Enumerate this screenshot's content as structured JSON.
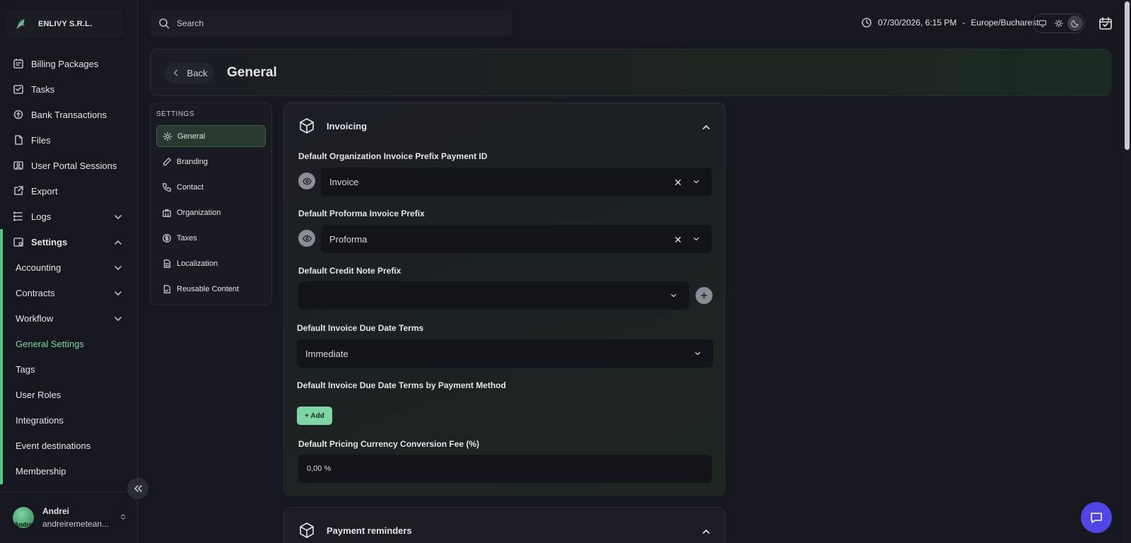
{
  "org": {
    "name": "ENLIVY S.R.L."
  },
  "sidebar": {
    "items": [
      {
        "label": "Billing Packages",
        "icon": "package-icon"
      },
      {
        "label": "Tasks",
        "icon": "tasks-icon"
      },
      {
        "label": "Bank Transactions",
        "icon": "bank-icon"
      },
      {
        "label": "Files",
        "icon": "file-icon"
      },
      {
        "label": "User Portal Sessions",
        "icon": "portal-icon"
      },
      {
        "label": "Export",
        "icon": "export-icon"
      },
      {
        "label": "Logs",
        "icon": "logs-icon"
      },
      {
        "label": "Settings",
        "icon": "settings-icon"
      }
    ],
    "sub_items": [
      "Accounting",
      "Contracts",
      "Workflow",
      "General Settings",
      "Tags",
      "User Roles",
      "Integrations",
      "Event destinations",
      "Membership"
    ],
    "active_sub": "General Settings"
  },
  "user": {
    "name": "Andrei",
    "email": "andreiremetean...",
    "avatar_text": "Andre"
  },
  "topbar": {
    "search_placeholder": "Search",
    "datetime": "07/30/2026, 6:15 PM",
    "separator": "-",
    "timezone": "Europe/Bucharest",
    "theme": "dark"
  },
  "header": {
    "back_label": "Back",
    "title": "General"
  },
  "settings_nav": {
    "title": "SETTINGS",
    "items": [
      "General",
      "Branding",
      "Contact",
      "Organization",
      "Taxes",
      "Localization",
      "Reusable Content"
    ],
    "active": "General"
  },
  "invoicing": {
    "title": "Invoicing",
    "org_prefix_label": "Default Organization Invoice Prefix Payment ID",
    "org_prefix_value": "Invoice",
    "proforma_label": "Default Proforma Invoice Prefix",
    "proforma_value": "Proforma",
    "credit_note_label": "Default Credit Note Prefix",
    "credit_note_value": "",
    "due_terms_label": "Default Invoice Due Date Terms",
    "due_terms_value": "Immediate",
    "due_terms_payment_label": "Default Invoice Due Date Terms by Payment Method",
    "add_label": "+ Add",
    "fee_label": "Default Pricing Currency Conversion Fee (%)",
    "fee_value": "0,00 %"
  },
  "payment_reminders": {
    "title": "Payment reminders"
  },
  "colors": {
    "accent": "#7fd6a4",
    "chat": "#4f46e5",
    "background": "#16171f"
  }
}
